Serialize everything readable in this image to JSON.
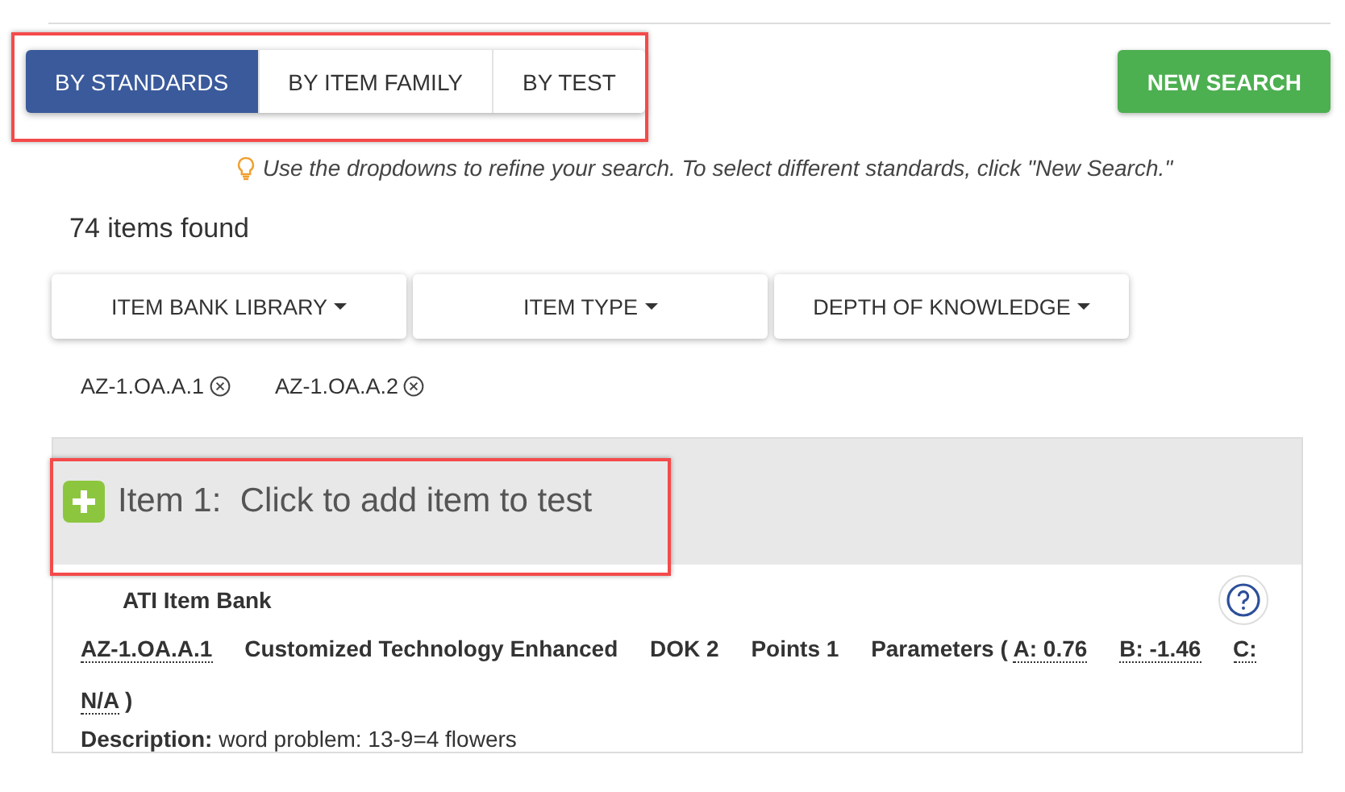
{
  "tabs": [
    {
      "label": "BY STANDARDS",
      "selected": true
    },
    {
      "label": "BY ITEM FAMILY",
      "selected": false
    },
    {
      "label": "BY TEST",
      "selected": false
    }
  ],
  "new_search_button": "NEW SEARCH",
  "hint": "Use the dropdowns to refine your search. To select different standards, click \"New Search.\"",
  "result_count": "74 items found",
  "filters": [
    "ITEM BANK LIBRARY",
    "ITEM TYPE",
    "DEPTH OF KNOWLEDGE"
  ],
  "selected_standards": [
    "AZ-1.OA.A.1",
    "AZ-1.OA.A.2"
  ],
  "item": {
    "title": "Item 1:  Click to add item to test",
    "bank": "ATI Item Bank",
    "standard": "AZ-1.OA.A.1",
    "type": "Customized Technology Enhanced",
    "dok": "DOK 2",
    "points": "Points 1",
    "parameters_label": "Parameters (",
    "parameters": [
      "A: 0.76",
      "B: -1.46",
      "C: N/A"
    ],
    "parameters_close": ")",
    "description": "**Description:** word problem: 13-9=4 flowers"
  }
}
